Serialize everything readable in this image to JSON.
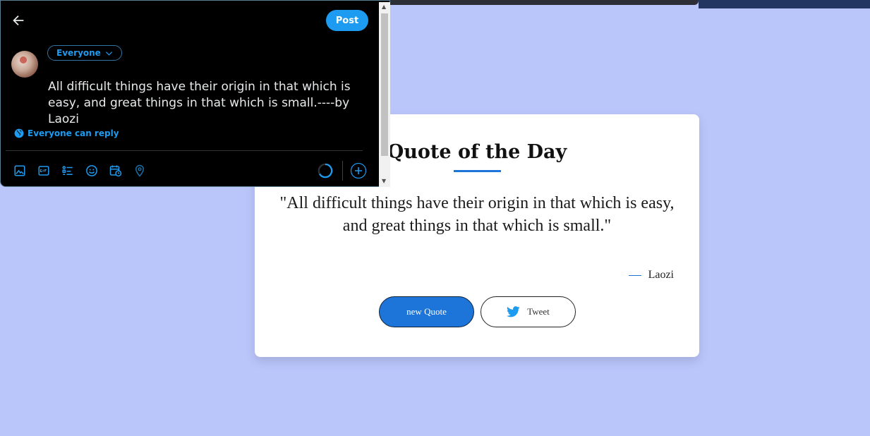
{
  "compose": {
    "post_label": "Post",
    "audience_label": "Everyone",
    "tweet_text": "All difficult things have their origin in that which is easy, and great things in that which is small.----by Laozi",
    "reply_setting": "Everyone can reply",
    "tools": [
      "image-icon",
      "gif-icon",
      "poll-icon",
      "emoji-icon",
      "schedule-icon",
      "location-icon"
    ]
  },
  "card": {
    "title": "Quote of the Day",
    "quote": "\"All difficult things have their origin in that which is easy, and great things in that which is small.\"",
    "author": "Laozi",
    "new_quote_label": "new Quote",
    "tweet_label": "Tweet"
  },
  "colors": {
    "background": "#bac5fa",
    "accent": "#1d74d9",
    "twitter_blue": "#1d9bf0"
  }
}
